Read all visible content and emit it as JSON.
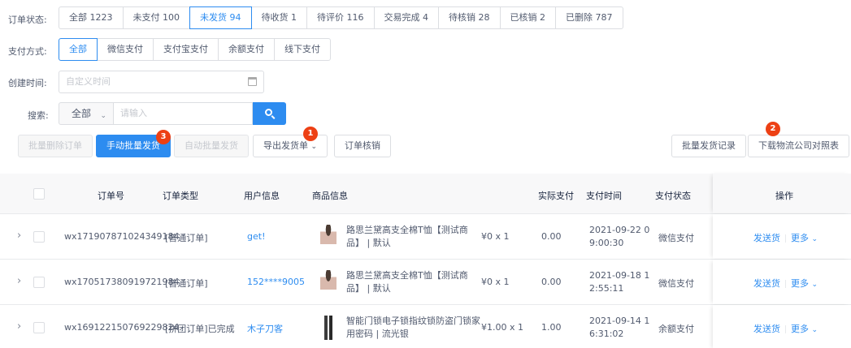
{
  "filters": {
    "order_status": {
      "label": "订单状态:",
      "options": [
        "全部 1223",
        "未支付 100",
        "未发货 94",
        "待收货 1",
        "待评价 116",
        "交易完成 4",
        "待核销 28",
        "已核销 2",
        "已删除 787"
      ],
      "selected_index": 2
    },
    "payment": {
      "label": "支付方式:",
      "options": [
        "全部",
        "微信支付",
        "支付宝支付",
        "余额支付",
        "线下支付"
      ],
      "selected_index": 0
    },
    "created": {
      "label": "创建时间:",
      "placeholder": "自定义时间"
    },
    "search": {
      "label": "搜索:",
      "scope": "全部",
      "placeholder": "请输入"
    }
  },
  "toolbar": {
    "batch_delete": "批量删除订单",
    "manual_ship": "手动批量发货",
    "auto_ship": "自动批量发货",
    "export": "导出发货单",
    "verify": "订单核销",
    "ship_records": "批量发货记录",
    "download_logistics": "下载物流公司对照表",
    "badges": [
      "1",
      "2",
      "3"
    ]
  },
  "table": {
    "headers": {
      "order_no": "订单号",
      "order_type": "订单类型",
      "user": "用户信息",
      "product": "商品信息",
      "paid": "实际支付",
      "pay_time": "支付时间",
      "pay_status": "支付状态",
      "actions": "操作"
    },
    "rows": [
      {
        "order_no": "wx171907871024349184",
        "order_type": "[普通订单]",
        "user": "get!",
        "product": "路思兰黛高支全棉T恤【测试商品】 | 默认",
        "price_qty": "¥0 x 1",
        "paid": "0.00",
        "pay_time": "2021-09-22 09:00:30",
        "pay_status": "微信支付",
        "ship": "发送货",
        "more": "更多",
        "img": "shirt"
      },
      {
        "order_no": "wx170517380919721984",
        "order_type": "[普通订单]",
        "user": "152****9005",
        "product": "路思兰黛高支全棉T恤【测试商品】 | 默认",
        "price_qty": "¥0 x 1",
        "paid": "0.00",
        "pay_time": "2021-09-18 12:55:11",
        "pay_status": "微信支付",
        "ship": "发送货",
        "more": "更多",
        "img": "shirt"
      },
      {
        "order_no": "wx169122150769229824",
        "order_type": "[拼团订单]已完成",
        "user": "木子刀客",
        "product": "智能门锁电子锁指纹锁防盗门锁家用密码 | 流光银",
        "price_qty": "¥1.00 x 1",
        "paid": "1.00",
        "pay_time": "2021-09-14 16:31:02",
        "pay_status": "余额支付",
        "ship": "发送货",
        "more": "更多",
        "img": "lock"
      }
    ]
  },
  "colors": {
    "primary": "#2d8cf0",
    "badge": "#ed4014"
  }
}
